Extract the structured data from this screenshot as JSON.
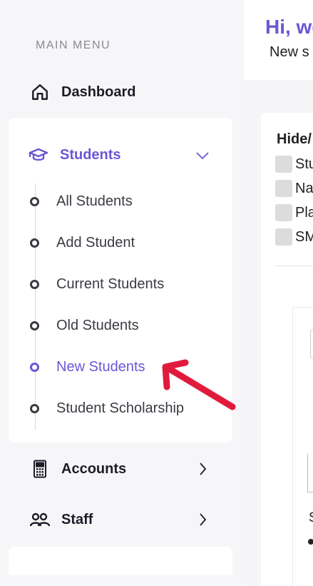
{
  "sidebar": {
    "caption": "MAIN MENU",
    "dashboard": "Dashboard",
    "students": {
      "label": "Students",
      "items": [
        {
          "label": "All Students",
          "active": false
        },
        {
          "label": "Add Student",
          "active": false
        },
        {
          "label": "Current Students",
          "active": false
        },
        {
          "label": "Old Students",
          "active": false
        },
        {
          "label": "New Students",
          "active": true
        },
        {
          "label": "Student Scholarship",
          "active": false
        }
      ]
    },
    "accounts": "Accounts",
    "staff": "Staff"
  },
  "header": {
    "greeting": "Hi, we",
    "subtitle": "New s"
  },
  "panel": {
    "hide_label": "Hide/",
    "checkboxes": [
      "Stu",
      "Na",
      "Pla",
      "SM"
    ],
    "s_text": "S"
  },
  "icons": {
    "dashboard": "home-icon",
    "students": "graduation-cap-icon",
    "accounts": "calculator-icon",
    "staff": "people-icon",
    "annotation": "red-arrow"
  },
  "colors": {
    "accent": "#6b57d6",
    "annotation": "#e01b3c"
  }
}
